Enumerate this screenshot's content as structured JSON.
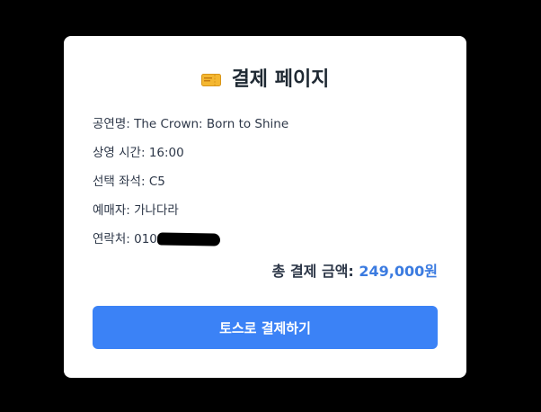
{
  "page": {
    "title": "결제 페이지",
    "title_icon": "ticket-icon"
  },
  "details": {
    "show": {
      "label": "공연명",
      "sep": ": ",
      "value": "The Crown: Born to Shine"
    },
    "time": {
      "label": "상영 시간",
      "sep": ": ",
      "value": "16:00"
    },
    "seat": {
      "label": "선택 좌석",
      "sep": ": ",
      "value": "C5"
    },
    "buyer": {
      "label": "예매자",
      "sep": ": ",
      "value": "가나다라"
    },
    "contact": {
      "label": "연락처",
      "sep": ": ",
      "value": "010"
    }
  },
  "total": {
    "label": "총 결제 금액: ",
    "amount": "249,000원"
  },
  "pay_button": {
    "label": "토스로 결제하기"
  },
  "colors": {
    "background": "#000000",
    "card": "#ffffff",
    "accent": "#3b82f6",
    "amount": "#3b7be0"
  }
}
